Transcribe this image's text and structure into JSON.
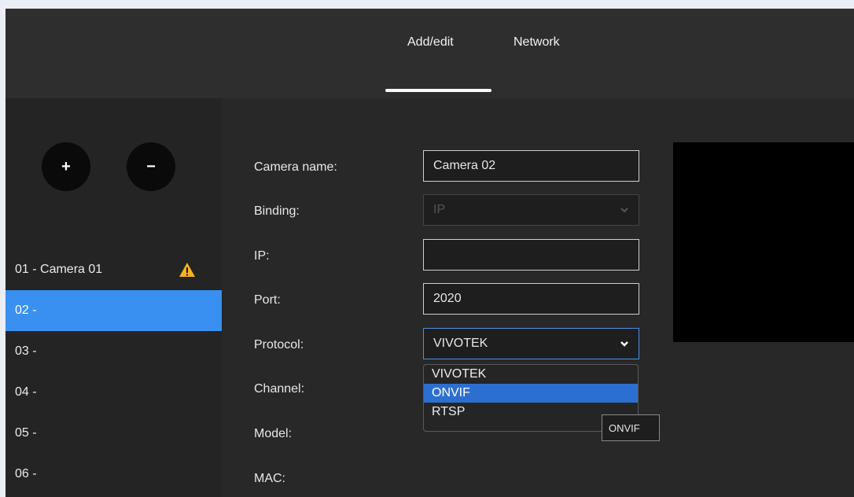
{
  "tabs": [
    {
      "label": "Add/edit",
      "active": true
    },
    {
      "label": "Network",
      "active": false
    }
  ],
  "toolbar": {
    "add_label": "+",
    "remove_label": "−"
  },
  "camera_list": [
    {
      "label": "01 - Camera 01",
      "warning": true
    },
    {
      "label": "02 -",
      "selected": true
    },
    {
      "label": "03 -"
    },
    {
      "label": "04 -"
    },
    {
      "label": "05 -"
    },
    {
      "label": "06 -"
    }
  ],
  "form": {
    "camera_name": {
      "label": "Camera name:",
      "value": "Camera 02"
    },
    "binding": {
      "label": "Binding:",
      "value": "IP",
      "disabled": true
    },
    "ip": {
      "label": "IP:",
      "value": ""
    },
    "port": {
      "label": "Port:",
      "value": "2020"
    },
    "protocol": {
      "label": "Protocol:",
      "value": "VIVOTEK",
      "options": [
        "VIVOTEK",
        "ONVIF",
        "RTSP"
      ],
      "highlighted": "ONVIF"
    },
    "channel": {
      "label": "Channel:"
    },
    "model": {
      "label": "Model:"
    },
    "mac": {
      "label": "MAC:"
    }
  },
  "tooltip": {
    "text": "ONVIF"
  },
  "colors": {
    "accent": "#3a90f0",
    "warning": "#f5b21e",
    "highlight": "#2d6fd0"
  }
}
